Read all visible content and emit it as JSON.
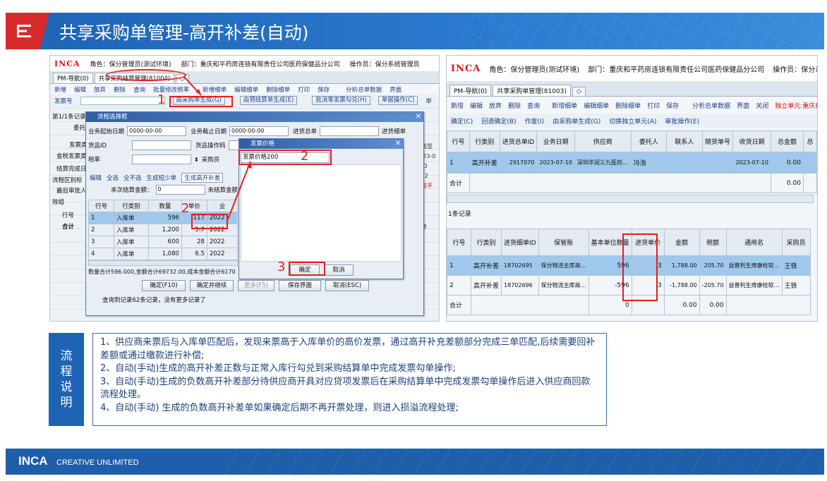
{
  "slide": {
    "title": "共享采购单管理-高开补差(自动)"
  },
  "left_screenshot": {
    "header": {
      "brand": "INCA",
      "role": "角色：保分管理员(测试环境)",
      "dept": "部门：重庆和平药房连锁有限责任公司医药保健品分公司",
      "operator": "操作员：保分系统管理员"
    },
    "tabs": [
      "PM-导航(0)",
      "共享采购结算管理(81004)",
      "◇"
    ],
    "toolbar": [
      "新增",
      "编辑",
      "放弃",
      "删除",
      "查询",
      "批量修改税率",
      "新增细单",
      "编辑细单",
      "删除细单",
      "打印",
      "保存",
      "分析总单数据",
      "界面"
    ],
    "row2": {
      "label": "发票号",
      "btn1": "由采购单生成(G)",
      "btn2": "由预结算单生成(E)",
      "btn3": "批消零发票勾兑(H)",
      "btn4": "单据操作(C)",
      "btn5": "单"
    },
    "side_labels": [
      "第1/1条记录",
      "委托",
      "发票类",
      "金税发票类",
      "结算完成日",
      "流程区别标",
      "最后审批人",
      "效组",
      "行号",
      "合计"
    ],
    "right_fragments": [
      "结",
      "账类型",
      "2023-0",
      "店ID",
      "1.82",
      "夫和平",
      "发",
      "本单",
      "计"
    ],
    "main_dialog": {
      "title": "流程选择框",
      "fields": [
        "业务起始日期",
        "0000-00-00",
        "业务截止日期",
        "0000-00-00",
        "进货总单",
        "进货细单",
        "货品ID",
        "货品操作码",
        "税率",
        "采购员"
      ],
      "toolbar": [
        "编辑",
        "全选",
        "全不选",
        "生成短少单",
        "生成高开补差"
      ],
      "sum_label": "本次结算金额：",
      "sum_value": "0",
      "unsettled_label": "未结算金额",
      "table_headers": [
        "行号",
        "行类别",
        "数量",
        "单价",
        "业"
      ],
      "rows": [
        {
          "no": "1",
          "type": "入库单",
          "qty": "596",
          "price": "117",
          "biz": "2022"
        },
        {
          "no": "2",
          "type": "入库单",
          "qty": "1,200",
          "price": "5.7",
          "biz": "2022"
        },
        {
          "no": "3",
          "type": "入库单",
          "qty": "600",
          "price": "28",
          "biz": "2022"
        },
        {
          "no": "4",
          "type": "入库单",
          "qty": "1,080",
          "price": "6.5",
          "biz": "2022"
        }
      ],
      "status": "数量合计596.000,金额合计69732.00,成本金额合计6170",
      "buttons": [
        "确定(F10)",
        "确定并继续",
        "更多(F5)",
        "保存界面",
        "取消(ESC)"
      ],
      "footer_msg": "查询到记录62条记录，没有更多记录了"
    },
    "price_dialog": {
      "title": "发票价格",
      "input_value": "发票价格200",
      "ok": "确定",
      "cancel": "取消"
    },
    "annotations": [
      "1",
      "2",
      "2",
      "3"
    ]
  },
  "right_screenshot": {
    "header": {
      "brand": "INCA",
      "role": "角色：保分管理员(测试环境)",
      "dept": "部门：重庆和平药房连锁有限责任公司医药保健品分公司",
      "operator": "操作员：保分系统管理员"
    },
    "tabs": [
      "PM-导航(0)",
      "共享采购单管理(81003)",
      "◇"
    ],
    "toolbar": [
      "新增",
      "编辑",
      "放弃",
      "删除",
      "查询",
      "新增细单",
      "编辑细单",
      "删除细单",
      "打印",
      "保存",
      "分析总单数据",
      "界面",
      "关闭",
      "独立单元:重庆和平"
    ],
    "toolbar2": [
      "确定(C)",
      "回退确定(B)",
      "作废(I)",
      "由采购单生成(G)",
      "切换独立单元(A)",
      "审批操作(E)"
    ],
    "top_table": {
      "headers": [
        "行号",
        "行类别",
        "进货总单ID",
        "业务日期",
        "供应商",
        "委托人",
        "联系人",
        "随货单号",
        "收货日期",
        "总金额",
        "总"
      ],
      "row": {
        "no": "1",
        "type": "高开补差",
        "id": "2917070",
        "date": "2023-07-10",
        "supplier": "深圳华润三九医药…",
        "client": "冯浩",
        "contact": "",
        "ref": "",
        "recv": "2023-07-10",
        "total": "0.00"
      },
      "sum_label": "合计",
      "sum_value": "0.00"
    },
    "record_count": "1条记录",
    "bottom_table": {
      "headers": [
        "行号",
        "行类别",
        "进货细单ID",
        "保管账",
        "基本单位数量",
        "进货单价",
        "金额",
        "税额",
        "通用名",
        "采购员"
      ],
      "rows": [
        {
          "no": "1",
          "type": "高开补差",
          "id": "18702695",
          "acct": "保分物流主库商…",
          "qty": "596",
          "price": "3",
          "amount": "1,788.00",
          "tax": "205.70",
          "name": "益普利生痔康栓软…",
          "buyer": "王铁"
        },
        {
          "no": "2",
          "type": "高开补差",
          "id": "18702696",
          "acct": "保分物流主库商…",
          "qty": "-596",
          "price": "3",
          "amount": "-1,788.00",
          "tax": "-205.70",
          "name": "益普利生痔康栓软…",
          "buyer": "王铁"
        }
      ],
      "sum_label": "合计",
      "sum_qty": "0",
      "sum_amount": "0.00",
      "sum_tax": "0.00"
    }
  },
  "flow": {
    "label": [
      "流",
      "程",
      "说",
      "明"
    ],
    "lines": [
      "1、供应商来票后与入库单匹配后，发现来票高于入库单价的高价发票，通过高开补充差额部分完成三单匹配,后续需要回补差额或通过缴款进行补偿;",
      "2、自动(手动)生成的高开补差正数与正常入库行勾兑到采购结算单中完成发票勾单操作;",
      "3、自动(手动)生成的负数高开补差部分待供应商开具对应贷项发票后在采购结算单中完成发票勾单操作后进入供应商回款流程处理。",
      "4、自动(手动) 生成的负数高开补差单如果确定后期不再开票处理，则进入损溢流程处理;"
    ]
  },
  "footer": {
    "brand": "INCA",
    "tagline": "CREATIVE UNLIMITED"
  },
  "colors": {
    "title_blue": "#1f63b4",
    "accent_red": "#d92b2b",
    "annot_red": "#e02020",
    "row_select": "#9fc8ec"
  }
}
